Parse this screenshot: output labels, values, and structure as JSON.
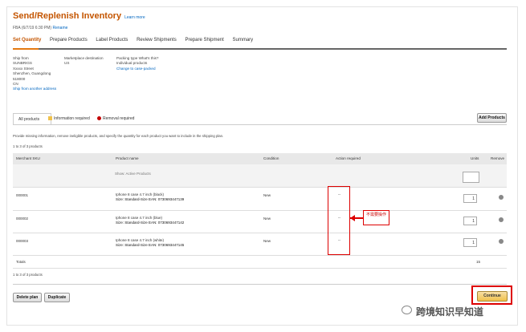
{
  "page": {
    "title": "Send/Replenish Inventory",
    "learn_more": "Learn more",
    "subtitle_prefix": "FBA (6/7/19 6:30 PM)",
    "subtitle_ref": "Rename"
  },
  "steps": {
    "items": [
      "Set Quantity",
      "Prepare Products",
      "Label Products",
      "Review Shipments",
      "Prepare Shipment",
      "Summary"
    ],
    "active_index": 0
  },
  "ship_from": {
    "heading": "Ship from",
    "lines": [
      "SUNBRIGS",
      "Xxxxx Street",
      "Shenzhen, Guangdong",
      "518000",
      "CN"
    ],
    "link": "Ship from another address"
  },
  "marketplace": {
    "heading": "Marketplace destination",
    "value": "US"
  },
  "packing": {
    "heading": "Packing type What's this?",
    "value": "Individual products",
    "link": "Change to case-packed"
  },
  "tabs": {
    "all": "All products",
    "info": "Information required",
    "removal": "Removal required",
    "add_products": "Add Products"
  },
  "instructions": "Provide missing information, remove ineligible products, and specify the quantity for each product you want to include in the shipping plan.",
  "count_label": "1 to 3 of 3 products",
  "table": {
    "headers": {
      "sku": "Merchant SKU",
      "product": "Product name",
      "condition": "Condition",
      "action": "Action required",
      "units": "Units",
      "remove": "Remove"
    },
    "filter_label": "Show: Active Products",
    "rows": [
      {
        "sku": "000001",
        "name": "Iphone 8 case 4.7 inch (black)",
        "asin": "Size: Standard-Size EAN: 0730693447139",
        "condition": "New",
        "action": "--",
        "units": "1"
      },
      {
        "sku": "000002",
        "name": "Iphone 8 case 4.7 inch (blue)",
        "asin": "Size: Standard-Size EAN: 0730693447142",
        "condition": "New",
        "action": "--",
        "units": "1"
      },
      {
        "sku": "000003",
        "name": "Iphone 8 case 4.7 inch (white)",
        "asin": "Size: Standard-Size EAN: 0730693447145",
        "condition": "New",
        "action": "--",
        "units": "1"
      }
    ],
    "totals_label": "Totals",
    "totals_units": "15"
  },
  "annotation": {
    "callout": "不需要操作"
  },
  "footer": {
    "count_label": "1 to 3 of 3 products",
    "delete_plan": "Delete plan",
    "duplicate": "Duplicate",
    "continue": "Continue"
  },
  "watermark": "跨境知识早知道",
  "colors": {
    "accent": "#c45500",
    "step_active": "#e47911",
    "link": "#0066c0",
    "annotation": "#dd0000"
  }
}
